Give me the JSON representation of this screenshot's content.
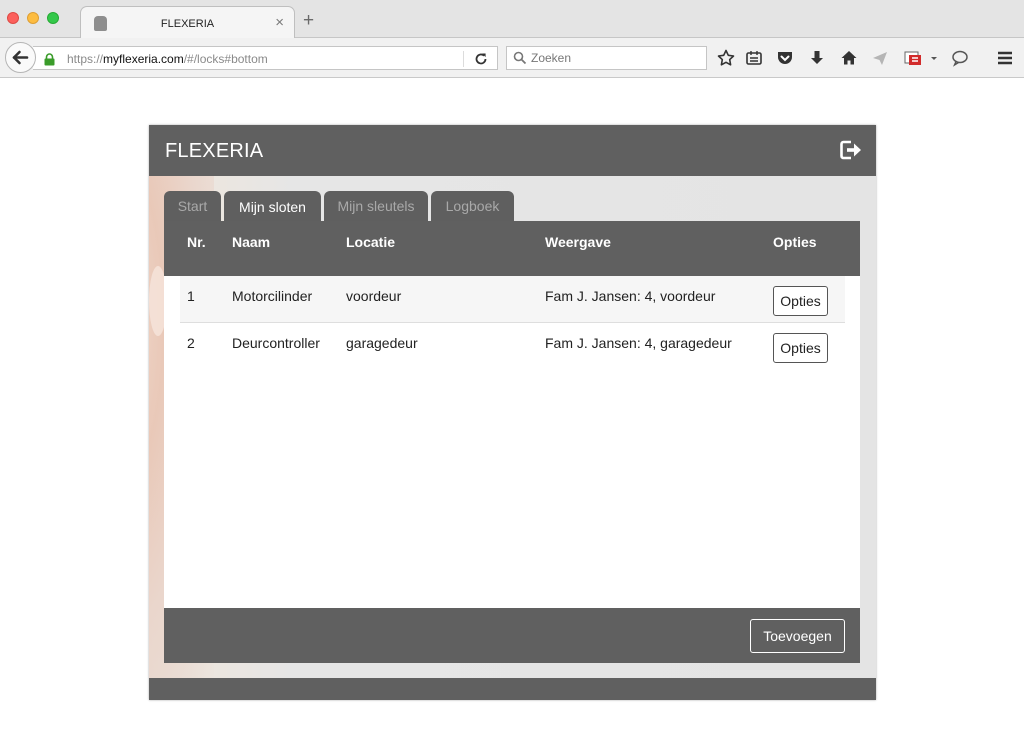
{
  "browser": {
    "tab_title": "FLEXERIA",
    "url_prefix": "https://",
    "url_domain": "myflexeria.com",
    "url_path": "/#/locks#bottom",
    "search_placeholder": "Zoeken"
  },
  "app": {
    "title": "FLEXERIA",
    "tabs": [
      {
        "label": "Start",
        "active": false
      },
      {
        "label": "Mijn sloten",
        "active": true
      },
      {
        "label": "Mijn sleutels",
        "active": false
      },
      {
        "label": "Logboek",
        "active": false
      }
    ],
    "table": {
      "headers": {
        "nr": "Nr.",
        "naam": "Naam",
        "locatie": "Locatie",
        "weergave": "Weergave",
        "opties": "Opties"
      },
      "rows": [
        {
          "nr": "1",
          "naam": "Motorcilinder",
          "locatie": "voordeur",
          "weergave": "Fam J. Jansen: 4, voordeur",
          "button": "Opties"
        },
        {
          "nr": "2",
          "naam": "Deurcontroller",
          "locatie": "garagedeur",
          "weergave": "Fam J. Jansen: 4, garagedeur",
          "button": "Opties"
        }
      ]
    },
    "add_button": "Toevoegen"
  },
  "colors": {
    "header_bg": "#606060",
    "accent_lock": "#3a9c2a"
  }
}
